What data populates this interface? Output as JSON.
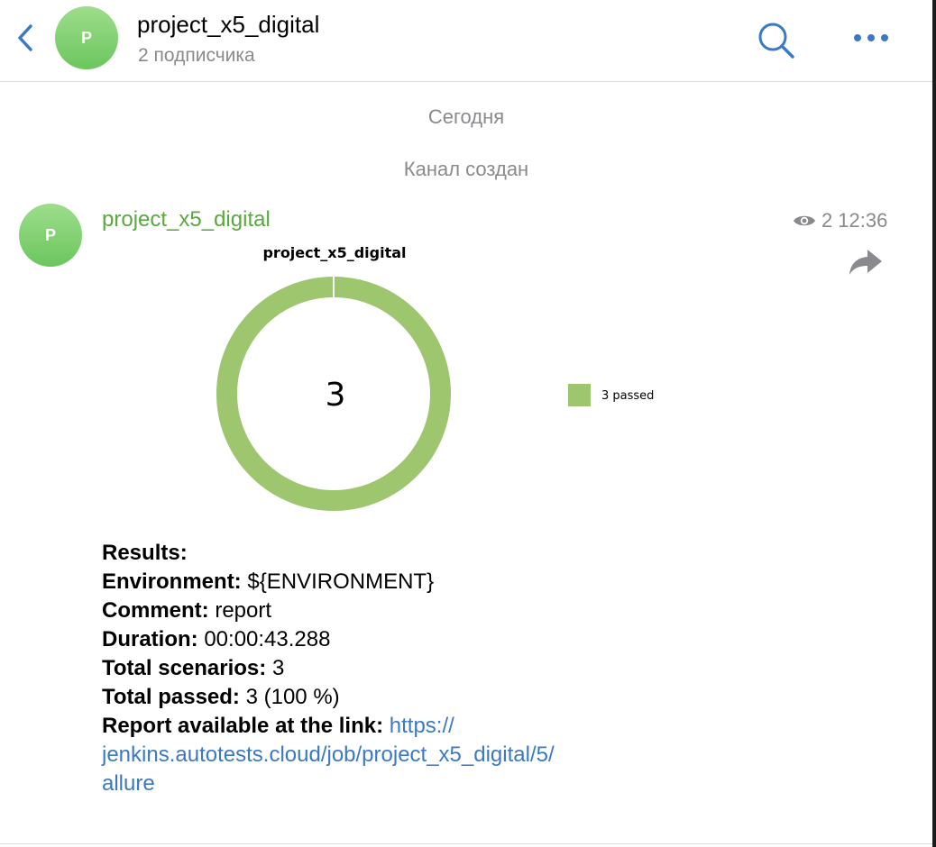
{
  "header": {
    "avatar_letter": "P",
    "title": "project_x5_digital",
    "subtitle": "2 подписчика",
    "icons": {
      "back": "chevron-left-icon",
      "search": "search-icon",
      "more": "more-dots-icon"
    }
  },
  "separators": {
    "today": "Сегодня",
    "created": "Канал создан"
  },
  "message": {
    "avatar_letter": "P",
    "author": "project_x5_digital",
    "views": "2",
    "time": "12:36",
    "share_icon": "share-icon"
  },
  "chart_data": {
    "type": "pie",
    "title": "project_x5_digital",
    "center_label": "3",
    "slices": [
      {
        "label": "3 passed",
        "value": 3,
        "color": "#9dc66e"
      }
    ]
  },
  "results": {
    "heading": "Results:",
    "environment_label": "Environment:",
    "environment_value": "${ENVIRONMENT}",
    "comment_label": "Comment:",
    "comment_value": "report",
    "duration_label": "Duration:",
    "duration_value": "00:00:43.288",
    "total_scenarios_label": "Total scenarios:",
    "total_scenarios_value": "3",
    "total_passed_label": "Total passed:",
    "total_passed_value": "3 (100 %)",
    "report_label": "Report available at the link:",
    "link_part1": "https://",
    "link_part2": "jenkins.autotests.cloud/job/project_x5_digital/5/",
    "link_part3": "allure"
  },
  "colors": {
    "accent": "#3b79c4",
    "author": "#5aa83f",
    "passed": "#9dc66e",
    "muted": "#8a8a8e"
  }
}
